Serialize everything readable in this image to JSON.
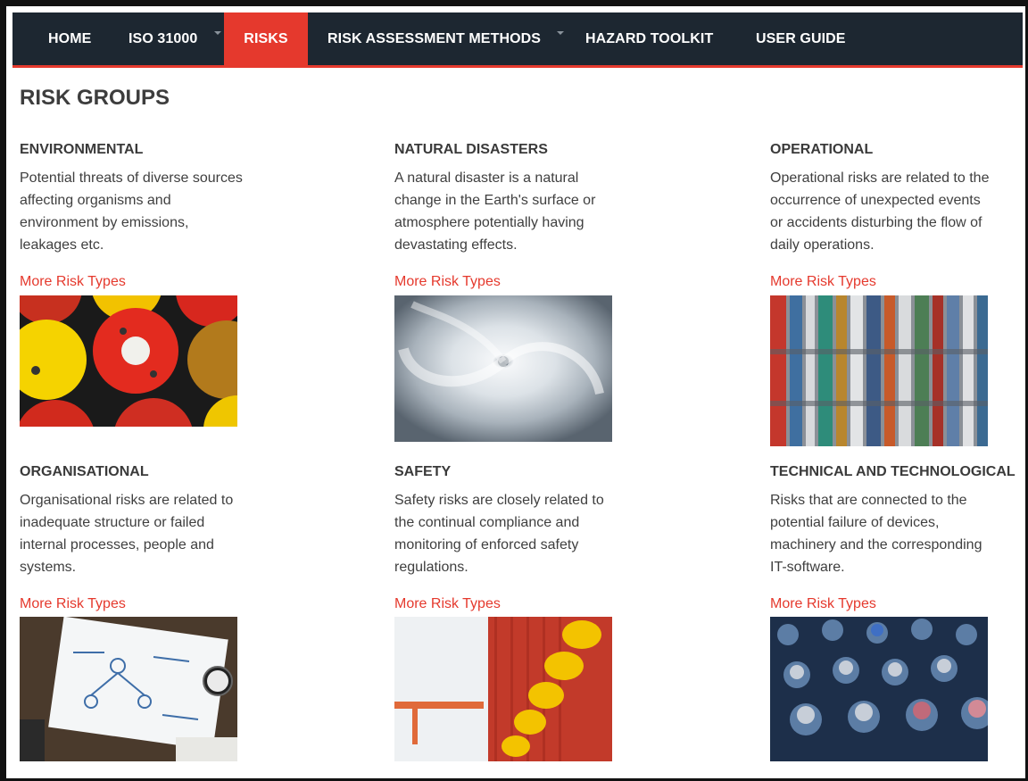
{
  "nav": {
    "items": [
      {
        "label": "HOME",
        "active": false,
        "dropdown": false
      },
      {
        "label": "ISO 31000",
        "active": false,
        "dropdown": true
      },
      {
        "label": "RISKS",
        "active": true,
        "dropdown": false
      },
      {
        "label": "RISK ASSESSMENT METHODS",
        "active": false,
        "dropdown": true
      },
      {
        "label": "HAZARD TOOLKIT",
        "active": false,
        "dropdown": false
      },
      {
        "label": "USER GUIDE",
        "active": false,
        "dropdown": false
      }
    ]
  },
  "page": {
    "title": "RISK GROUPS"
  },
  "groups": [
    {
      "title": "ENVIRONMENTAL",
      "description": "Potential threats of diverse sources affecting organisms and environment by emissions, leakages etc.",
      "link": "More Risk Types",
      "image": "colorful-oil-barrels"
    },
    {
      "title": "NATURAL DISASTERS",
      "description": "A natural disaster is a natural change in the Earth's surface or atmosphere potentially having devastating effects.",
      "link": "More Risk Types",
      "image": "hurricane-satellite"
    },
    {
      "title": "OPERATIONAL",
      "description": "Operational risks are related to the occurrence of unexpected events or accidents disturbing the flow of daily operations.",
      "link": "More Risk Types",
      "image": "shipping-containers-aerial"
    },
    {
      "title": "ORGANISATIONAL",
      "description": "Organisational risks are related to inadequate structure or failed internal processes, people and systems.",
      "link": "More Risk Types",
      "image": "business-plan-sketch"
    },
    {
      "title": "SAFETY",
      "description": "Safety risks are closely related to the continual compliance and monitoring of enforced safety regulations.",
      "link": "More Risk Types",
      "image": "yellow-hard-hats"
    },
    {
      "title": "TECHNICAL AND TECHNOLOGICAL",
      "description": "Risks that are connected to the potential failure of devices, machinery and the corresponding IT-software.",
      "link": "More Risk Types",
      "image": "mixing-console-knobs"
    }
  ],
  "colors": {
    "accent": "#e5392d",
    "nav_bg": "#1d2731",
    "text": "#3a3a3a"
  }
}
